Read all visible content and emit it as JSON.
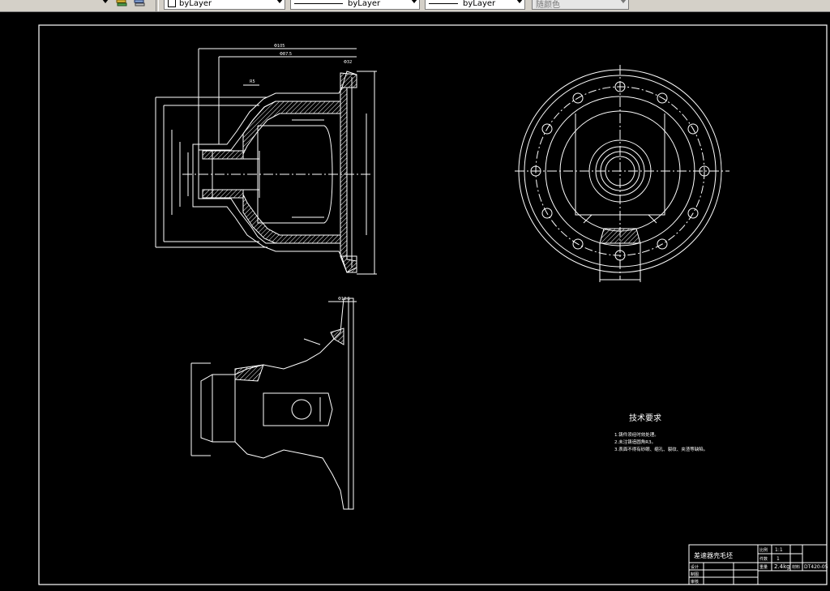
{
  "toolbar": {
    "color_value": "byLayer",
    "linetype_value": "byLayer",
    "lineweight_value": "byLayer",
    "plotstyle_value": "随颜色"
  },
  "drawing": {
    "tech_title": "技术要求",
    "tech_notes": [
      "1.铸件须经时效处理。",
      "2.未注铸造圆角R3。",
      "3.表面不得有砂眼、缩孔、裂纹、夹渣等缺陷。"
    ],
    "title_block": {
      "part_name": "差速器壳毛坯",
      "scale_label": "比例",
      "scale_value": "1:1",
      "count_label": "件数",
      "count_value": "1",
      "weight_label": "重量",
      "weight_value": "2.4kg",
      "material_label": "材料",
      "drawing_number": "DT420-05",
      "designer_label": "设计",
      "drafter_label": "制图",
      "checker_label": "审核"
    },
    "dims": {
      "top_overall": "Φ105",
      "top_inner": "Φ87.5",
      "top_right": "Φ32",
      "left_small": "R5",
      "bottom_top": "Φ12.5"
    }
  },
  "colors": {
    "background": "#000000",
    "line": "#ffffff",
    "toolbar": "#d4d0c8"
  }
}
